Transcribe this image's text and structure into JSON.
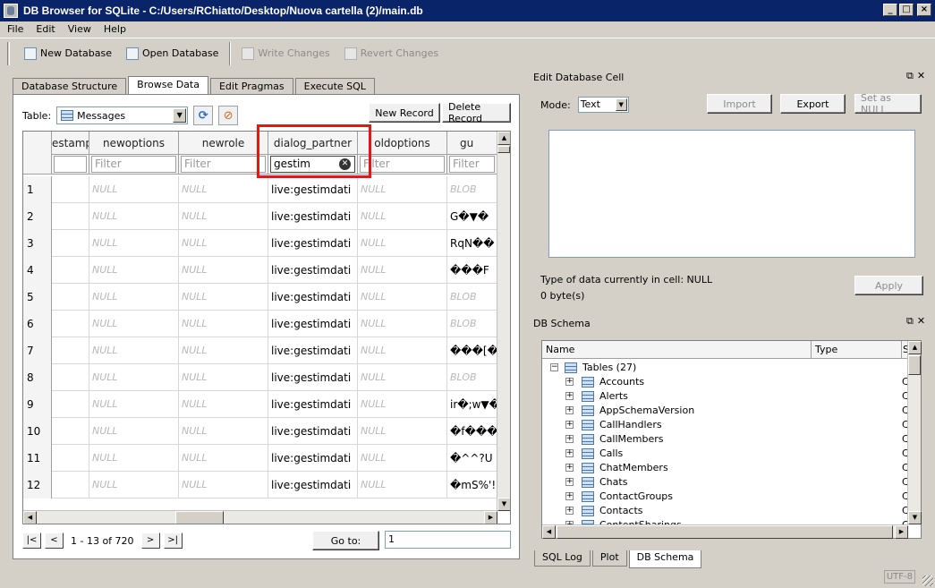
{
  "window": {
    "title": "DB Browser for SQLite - C:/Users/RChiatto/Desktop/Nuova cartella (2)/main.db",
    "min_glyph": "_",
    "max_glyph": "□",
    "close_glyph": "×"
  },
  "menu": [
    "File",
    "Edit",
    "View",
    "Help"
  ],
  "toolbar": {
    "new_database": "New Database",
    "open_database": "Open Database",
    "write_changes": "Write Changes",
    "revert_changes": "Revert Changes"
  },
  "main_tabs": [
    "Database Structure",
    "Browse Data",
    "Edit Pragmas",
    "Execute SQL"
  ],
  "browse": {
    "table_label": "Table:",
    "table_value": "Messages",
    "new_record": "New Record",
    "delete_record": "Delete Record",
    "columns": [
      "estamp",
      "newoptions",
      "newrole",
      "dialog_partner",
      "oldoptions",
      "gu"
    ],
    "filter_placeholder": "Filter",
    "active_filter": "gestim",
    "rows": [
      {
        "n": "1",
        "newoptions": "NULL",
        "newrole": "NULL",
        "dialog_partner": "live:gestimdati",
        "oldoptions": "NULL",
        "gu": "BLOB"
      },
      {
        "n": "2",
        "newoptions": "NULL",
        "newrole": "NULL",
        "dialog_partner": "live:gestimdati",
        "oldoptions": "NULL",
        "gu": "G�▼�"
      },
      {
        "n": "3",
        "newoptions": "NULL",
        "newrole": "NULL",
        "dialog_partner": "live:gestimdati",
        "oldoptions": "NULL",
        "gu": "RqN��"
      },
      {
        "n": "4",
        "newoptions": "NULL",
        "newrole": "NULL",
        "dialog_partner": "live:gestimdati",
        "oldoptions": "NULL",
        "gu": "���F"
      },
      {
        "n": "5",
        "newoptions": "NULL",
        "newrole": "NULL",
        "dialog_partner": "live:gestimdati",
        "oldoptions": "NULL",
        "gu": "BLOB"
      },
      {
        "n": "6",
        "newoptions": "NULL",
        "newrole": "NULL",
        "dialog_partner": "live:gestimdati",
        "oldoptions": "NULL",
        "gu": "BLOB"
      },
      {
        "n": "7",
        "newoptions": "NULL",
        "newrole": "NULL",
        "dialog_partner": "live:gestimdati",
        "oldoptions": "NULL",
        "gu": "���[�"
      },
      {
        "n": "8",
        "newoptions": "NULL",
        "newrole": "NULL",
        "dialog_partner": "live:gestimdati",
        "oldoptions": "NULL",
        "gu": "BLOB"
      },
      {
        "n": "9",
        "newoptions": "NULL",
        "newrole": "NULL",
        "dialog_partner": "live:gestimdati",
        "oldoptions": "NULL",
        "gu": "ir�;w▼�"
      },
      {
        "n": "10",
        "newoptions": "NULL",
        "newrole": "NULL",
        "dialog_partner": "live:gestimdati",
        "oldoptions": "NULL",
        "gu": "�f���"
      },
      {
        "n": "11",
        "newoptions": "NULL",
        "newrole": "NULL",
        "dialog_partner": "live:gestimdati",
        "oldoptions": "NULL",
        "gu": "�^^?U"
      },
      {
        "n": "12",
        "newoptions": "NULL",
        "newrole": "NULL",
        "dialog_partner": "live:gestimdati",
        "oldoptions": "NULL",
        "gu": "�mS%'!"
      }
    ],
    "position_text": "1 - 13 of 720",
    "goto_label": "Go to:",
    "goto_value": "1"
  },
  "edit_cell": {
    "title": "Edit Database Cell",
    "mode_label": "Mode:",
    "mode_value": "Text",
    "import": "Import",
    "export": "Export",
    "set_null": "Set as NULL",
    "type_text": "Type of data currently in cell: NULL",
    "size_text": "0 byte(s)",
    "apply": "Apply"
  },
  "schema": {
    "title": "DB Schema",
    "col_name": "Name",
    "col_type": "Type",
    "col_schema": "S",
    "root_label": "Tables (27)",
    "tables": [
      "Accounts",
      "Alerts",
      "AppSchemaVersion",
      "CallHandlers",
      "CallMembers",
      "Calls",
      "ChatMembers",
      "Chats",
      "ContactGroups",
      "Contacts",
      "ContentSharings"
    ],
    "sql_prefix": "C"
  },
  "bottom_tabs": [
    "SQL Log",
    "Plot",
    "DB Schema"
  ],
  "status": {
    "encoding": "UTF-8"
  }
}
